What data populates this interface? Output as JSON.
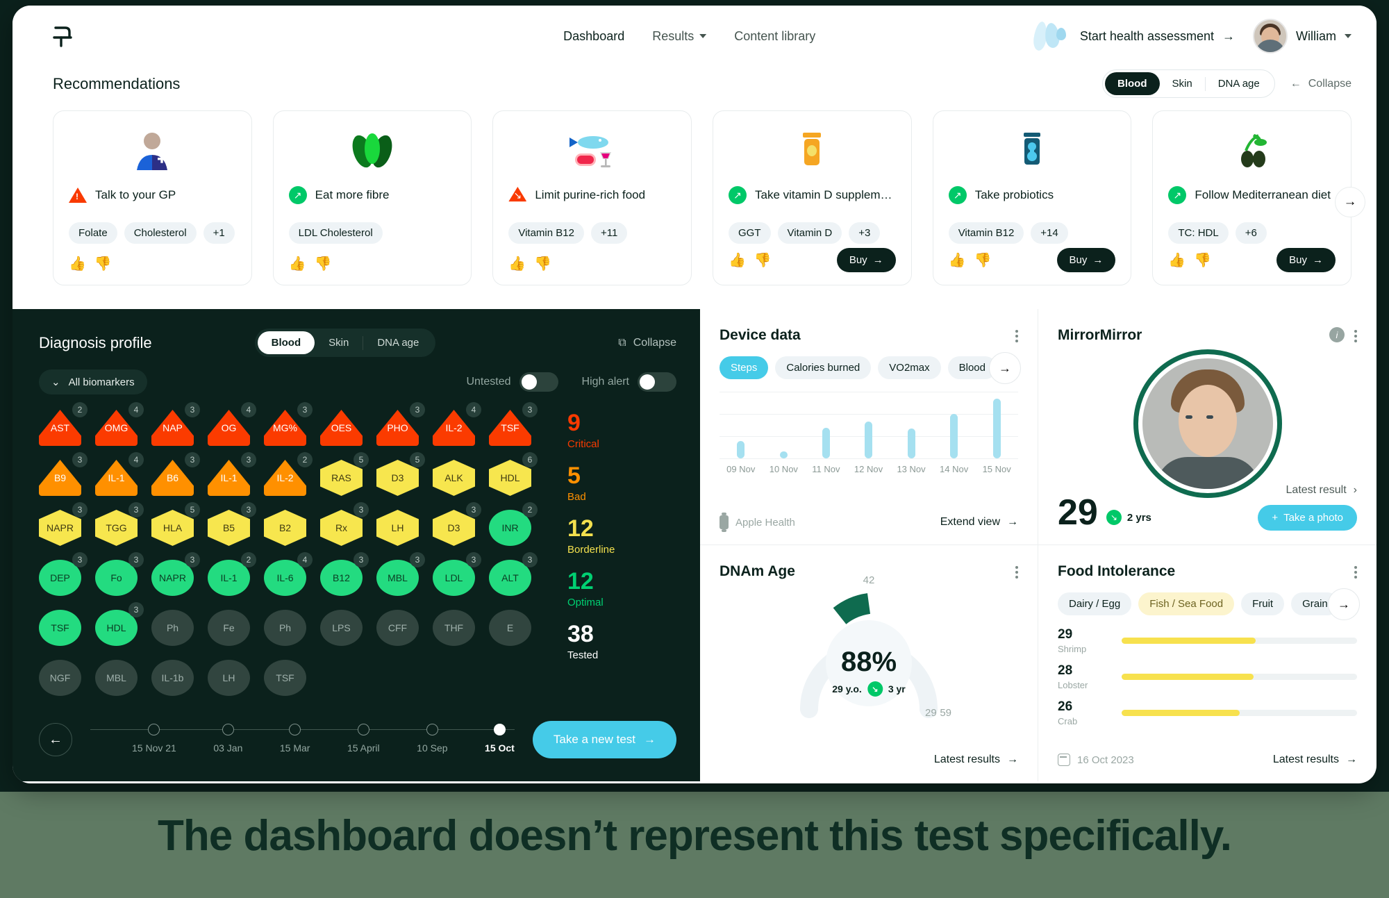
{
  "nav": {
    "logo_name": "brand-logo",
    "links": [
      {
        "label": "Dashboard",
        "active": true
      },
      {
        "label": "Results",
        "has_chevron": true
      },
      {
        "label": "Content library"
      }
    ],
    "assessment_cta": "Start health assessment",
    "user_name": "William"
  },
  "recommendations": {
    "title": "Recommendations",
    "tabs": [
      {
        "label": "Blood",
        "active": true
      },
      {
        "label": "Skin"
      },
      {
        "label": "DNA age"
      }
    ],
    "collapse_label": "Collapse",
    "cards": [
      {
        "illus": "doctor-icon",
        "status": "warning",
        "title": "Talk to your GP",
        "chips": [
          "Folate",
          "Cholesterol",
          "+1"
        ],
        "buy": null
      },
      {
        "illus": "leaf-icon",
        "status": "up",
        "title": "Eat more fibre",
        "chips": [
          "LDL Cholesterol"
        ],
        "buy": null
      },
      {
        "illus": "fish-meat-wine-icon",
        "status": "down",
        "title": "Limit purine-rich food",
        "chips": [
          "Vitamin B12",
          "+11"
        ],
        "buy": null
      },
      {
        "illus": "supplement-jar-icon",
        "status": "up",
        "title": "Take vitamin D supplement",
        "chips": [
          "GGT",
          "Vitamin D",
          "+3"
        ],
        "buy": "Buy"
      },
      {
        "illus": "probiotics-jar-icon",
        "status": "up",
        "title": "Take probiotics",
        "chips": [
          "Vitamin B12",
          "+14"
        ],
        "buy": "Buy"
      },
      {
        "illus": "olives-icon",
        "status": "up",
        "title": "Follow Mediterranean diet",
        "chips": [
          "TC: HDL",
          "+6"
        ],
        "buy": "Buy"
      }
    ]
  },
  "diagnosis": {
    "title": "Diagnosis profile",
    "tabs": [
      {
        "label": "Blood",
        "active": true
      },
      {
        "label": "Skin"
      },
      {
        "label": "DNA age"
      }
    ],
    "collapse_label": "Collapse",
    "all_biomarkers_label": "All biomarkers",
    "toggles": [
      {
        "label": "Untested",
        "on": false
      },
      {
        "label": "High alert",
        "on": false
      }
    ],
    "biomarkers": [
      {
        "code": "AST",
        "count": "2",
        "level": "critical"
      },
      {
        "code": "OMG",
        "count": "4",
        "level": "critical"
      },
      {
        "code": "NAP",
        "count": "3",
        "level": "critical"
      },
      {
        "code": "OG",
        "count": "4",
        "level": "critical"
      },
      {
        "code": "MG%",
        "count": "3",
        "level": "critical"
      },
      {
        "code": "OES",
        "count": "",
        "level": "critical"
      },
      {
        "code": "PHO",
        "count": "3",
        "level": "critical"
      },
      {
        "code": "IL-2",
        "count": "4",
        "level": "critical"
      },
      {
        "code": "TSF",
        "count": "3",
        "level": "critical"
      },
      {
        "code": "B9",
        "count": "3",
        "level": "bad"
      },
      {
        "code": "IL-1",
        "count": "4",
        "level": "bad"
      },
      {
        "code": "B6",
        "count": "3",
        "level": "bad"
      },
      {
        "code": "IL-1",
        "count": "3",
        "level": "bad"
      },
      {
        "code": "IL-2",
        "count": "2",
        "level": "bad"
      },
      {
        "code": "RAS",
        "count": "5",
        "level": "borderline"
      },
      {
        "code": "D3",
        "count": "5",
        "level": "borderline"
      },
      {
        "code": "ALK",
        "count": "",
        "level": "borderline"
      },
      {
        "code": "HDL",
        "count": "6",
        "level": "borderline"
      },
      {
        "code": "NAPR",
        "count": "3",
        "level": "borderline"
      },
      {
        "code": "TGG",
        "count": "3",
        "level": "borderline"
      },
      {
        "code": "HLA",
        "count": "5",
        "level": "borderline"
      },
      {
        "code": "B5",
        "count": "3",
        "level": "borderline"
      },
      {
        "code": "B2",
        "count": "",
        "level": "borderline"
      },
      {
        "code": "Rx",
        "count": "3",
        "level": "borderline"
      },
      {
        "code": "LH",
        "count": "",
        "level": "borderline"
      },
      {
        "code": "D3",
        "count": "3",
        "level": "borderline"
      },
      {
        "code": "INR",
        "count": "2",
        "level": "optimal"
      },
      {
        "code": "DEP",
        "count": "3",
        "level": "optimal"
      },
      {
        "code": "Fo",
        "count": "3",
        "level": "optimal"
      },
      {
        "code": "NAPR",
        "count": "3",
        "level": "optimal"
      },
      {
        "code": "IL-1",
        "count": "2",
        "level": "optimal"
      },
      {
        "code": "IL-6",
        "count": "4",
        "level": "optimal"
      },
      {
        "code": "B12",
        "count": "3",
        "level": "optimal"
      },
      {
        "code": "MBL",
        "count": "3",
        "level": "optimal"
      },
      {
        "code": "LDL",
        "count": "3",
        "level": "optimal"
      },
      {
        "code": "ALT",
        "count": "3",
        "level": "optimal"
      },
      {
        "code": "TSF",
        "count": "",
        "level": "optimal"
      },
      {
        "code": "HDL",
        "count": "3",
        "level": "optimal"
      },
      {
        "code": "Ph",
        "count": "",
        "level": "untested"
      },
      {
        "code": "Fe",
        "count": "",
        "level": "untested"
      },
      {
        "code": "Ph",
        "count": "",
        "level": "untested"
      },
      {
        "code": "LPS",
        "count": "",
        "level": "untested"
      },
      {
        "code": "CFF",
        "count": "",
        "level": "untested"
      },
      {
        "code": "THF",
        "count": "",
        "level": "untested"
      },
      {
        "code": "E",
        "count": "",
        "level": "untested"
      },
      {
        "code": "NGF",
        "count": "",
        "level": "untested"
      },
      {
        "code": "MBL",
        "count": "",
        "level": "untested"
      },
      {
        "code": "IL-1b",
        "count": "",
        "level": "untested"
      },
      {
        "code": "LH",
        "count": "",
        "level": "untested"
      },
      {
        "code": "TSF",
        "count": "",
        "level": "untested"
      }
    ],
    "stats": [
      {
        "num": "9",
        "cap": "Critical",
        "color": "#f93a00"
      },
      {
        "num": "5",
        "cap": "Bad",
        "color": "#ff9000"
      },
      {
        "num": "12",
        "cap": "Borderline",
        "color": "#f3e04e"
      },
      {
        "num": "12",
        "cap": "Optimal",
        "color": "#00d072"
      },
      {
        "num": "38",
        "cap": "Tested",
        "color": "#ffffff"
      }
    ],
    "timeline": [
      {
        "label": "15 Nov 21",
        "active": false
      },
      {
        "label": "03 Jan",
        "active": false
      },
      {
        "label": "15 Mar",
        "active": false
      },
      {
        "label": "15 April",
        "active": false
      },
      {
        "label": "10 Sep",
        "active": false
      },
      {
        "label": "15 Oct",
        "active": true
      }
    ],
    "new_test_label": "Take a new test"
  },
  "device_data": {
    "title": "Device data",
    "pills": [
      {
        "label": "Steps",
        "active": true
      },
      {
        "label": "Calories burned"
      },
      {
        "label": "VO2max"
      },
      {
        "label": "Blood"
      }
    ],
    "source": "Apple Health",
    "extend_label": "Extend view"
  },
  "mirror": {
    "title": "MirrorMirror",
    "age": "29",
    "delta": "2 yrs",
    "latest_label": "Latest result",
    "take_photo_label": "Take a photo"
  },
  "dnam": {
    "title": "DNAm Age",
    "percent": "88%",
    "age_label": "29 y.o.",
    "delta": "3 yr",
    "top_label": "42",
    "min_label": "29",
    "max_label": "59",
    "latest_label": "Latest results"
  },
  "food": {
    "title": "Food Intolerance",
    "pills": [
      {
        "label": "Dairy / Egg"
      },
      {
        "label": "Fish / Sea Food",
        "active": true
      },
      {
        "label": "Fruit"
      },
      {
        "label": "Grain"
      }
    ],
    "rows": [
      {
        "value": "29",
        "name": "Shrimp",
        "pct": 57
      },
      {
        "value": "28",
        "name": "Lobster",
        "pct": 56
      },
      {
        "value": "26",
        "name": "Crab",
        "pct": 50
      }
    ],
    "date": "16 Oct 2023",
    "latest_label": "Latest results"
  },
  "caption": "The dashboard doesn’t represent this test specifically.",
  "chart_data": {
    "type": "bar",
    "title": "Device data — Steps",
    "categories": [
      "09 Nov",
      "10 Nov",
      "11 Nov",
      "12 Nov",
      "13 Nov",
      "14 Nov",
      "15 Nov"
    ],
    "values": [
      26,
      10,
      46,
      55,
      45,
      67,
      90
    ],
    "ylim": [
      0,
      100
    ],
    "xlabel": "",
    "ylabel": "Steps",
    "grid": true,
    "legend": "none",
    "series_color": "#a5e0f0"
  }
}
